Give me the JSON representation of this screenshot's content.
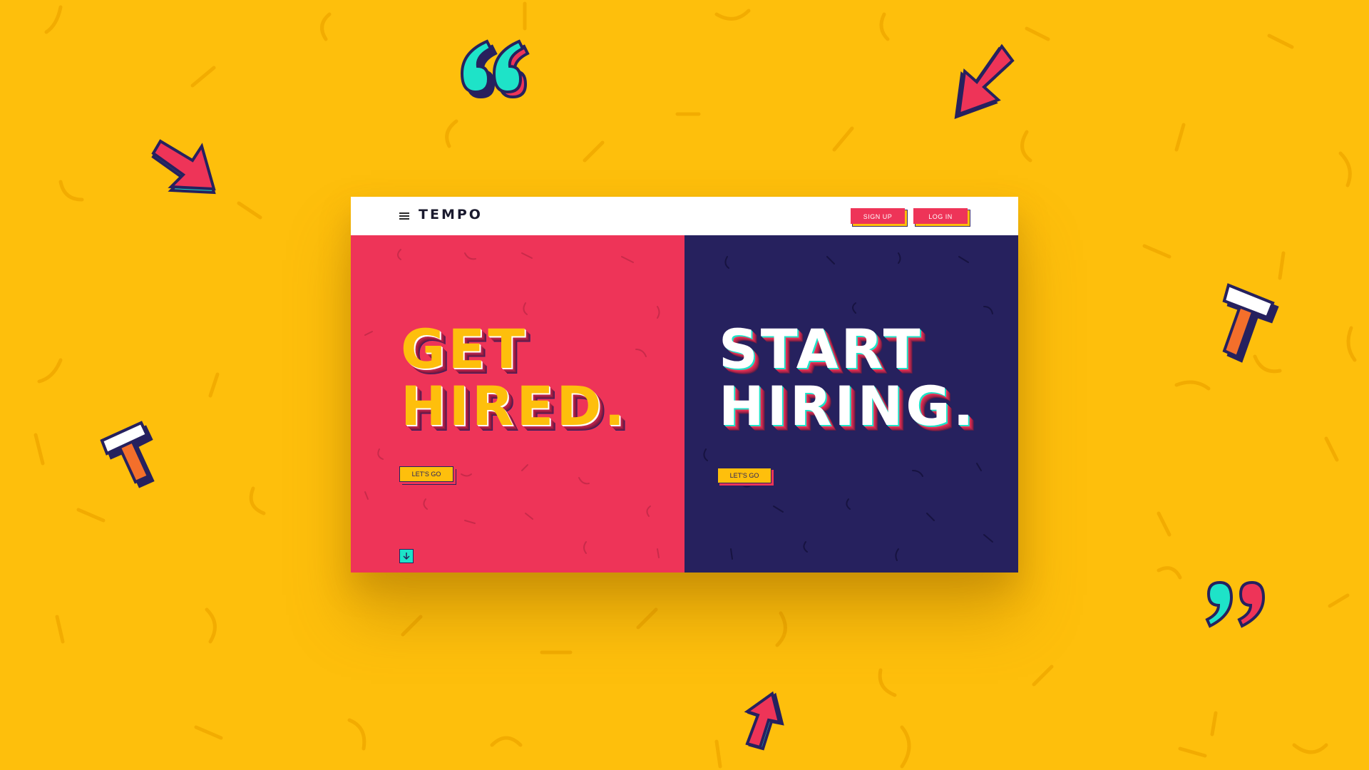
{
  "nav": {
    "logo": "TEMPO",
    "signup_label": "SIGN UP",
    "login_label": "LOG IN"
  },
  "left_panel": {
    "headline_line1": "GET",
    "headline_line2": "HIRED.",
    "cta_label": "LET'S GO"
  },
  "right_panel": {
    "headline_line1": "START",
    "headline_line2": "HIRING.",
    "cta_label": "LET'S GO"
  },
  "icons": {
    "menu": "hamburger-menu-icon",
    "scroll": "arrow-down-icon"
  },
  "colors": {
    "background": "#FEBF0C",
    "pink": "#EE3458",
    "navy": "#26215E",
    "teal": "#1ee3c8",
    "white": "#ffffff"
  }
}
